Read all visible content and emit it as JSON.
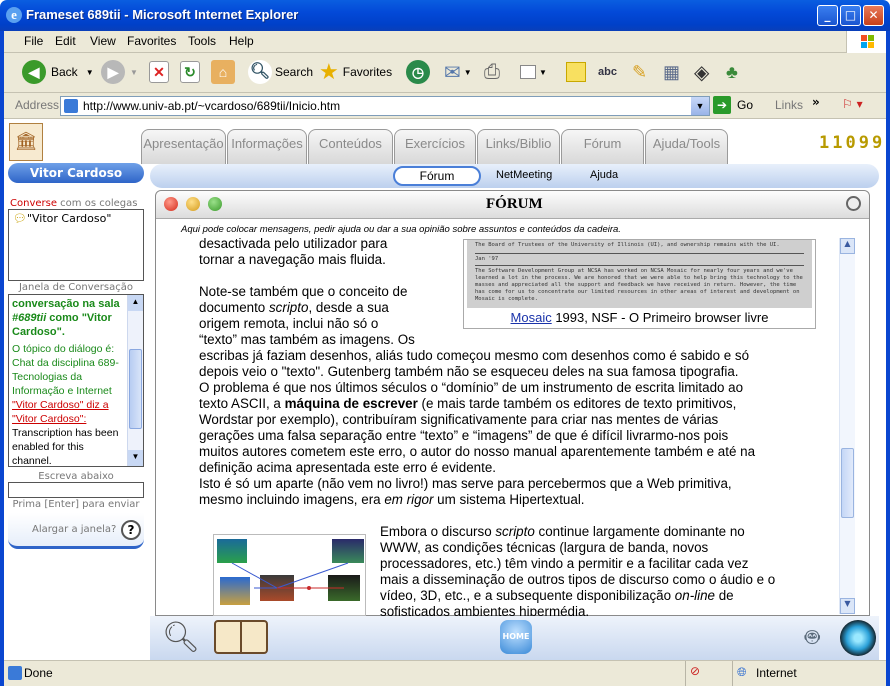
{
  "window": {
    "title": "Frameset 689tii - Microsoft Internet Explorer"
  },
  "menu": [
    "File",
    "Edit",
    "View",
    "Favorites",
    "Tools",
    "Help"
  ],
  "toolbar": {
    "back": "Back",
    "search": "Search",
    "favorites": "Favorites"
  },
  "address": {
    "label": "Address",
    "url": "http://www.univ-ab.pt/~vcardoso/689tii/Inicio.htm",
    "go": "Go",
    "links": "Links"
  },
  "status": {
    "text": "Done",
    "zone": "Internet"
  },
  "site": {
    "counter": "11099",
    "user_name": "Vitor Cardoso",
    "tabs": [
      "Apresentação",
      "Informações",
      "Conteúdos",
      "Exercícios",
      "Links/Biblio",
      "Fórum",
      "Ajuda/Tools"
    ],
    "subnav": [
      "Fórum",
      "NetMeeting",
      "Ajuda"
    ]
  },
  "chat": {
    "converse_hl": "Converse",
    "converse_rest": " com os colegas",
    "participant": "\"Vitor Cardoso\"",
    "janela_label": "Janela de Conversação",
    "log_line1": "conversação na sala ",
    "log_room": "#689tii",
    "log_line1b": " como \"Vitor Cardoso\".",
    "log_topic": "O tópico do diálogo é: Chat da disciplina 689-Tecnologias da Informação e Internet",
    "log_user1": "\"Vitor Cardoso\" diz a",
    "log_user2": "\"Vitor Cardoso\":",
    "log_msg": "Transcription has been enabled for this channel.",
    "write_label": "Escreva abaixo",
    "hint": "Prima [Enter] para enviar",
    "enlarge": "Alargar a janela?",
    "help_glyph": "?"
  },
  "forum": {
    "title": "FÓRUM",
    "subtitle": "Aqui pode colocar mensagens, pedir ajuda ou dar a sua opinião sobre assuntos e conteúdos da cadeira.",
    "p0a": "desactivada pelo utilizador para",
    "p0b": "tornar a navegação mais fluida.",
    "p1a": "Note-se também que o conceito de",
    "p1b_pre": "documento ",
    "p1b_em": "scripto",
    "p1b_post": ", desde a sua",
    "p1c": "origem remota, inclui não só o",
    "p1d": "“texto” mas também as imagens. Os",
    "p1e": "escribas já faziam desenhos, aliás tudo começou mesmo com desenhos como é sabido e só",
    "p1f": "depois veio o \"texto\". Gutenberg também não se esqueceu deles na sua famosa tipografia.",
    "p1g": "O problema é que nos últimos séculos o “domínio” de um instrumento de escrita limitado ao",
    "p1h_pre": "texto ASCII, a ",
    "p1h_b": "máquina de escrever",
    "p1h_post": " (e mais tarde também os editores de texto primitivos,",
    "p1i": "Wordstar por exemplo), contribuíram significativamente para criar nas mentes de várias",
    "p1j": "gerações uma falsa separação entre “texto” e “imagens” de que é difícil livrarmo-nos pois",
    "p1k": "muitos autores cometem este erro, o autor do nosso manual aparentemente também e até na",
    "p1l": "definição acima apresentada este erro é evidente.",
    "p2a": "Isto é só um aparte (não vem no livro!) mas serve para percebermos que a Web primitiva,",
    "p2b_pre": "mesmo incluindo imagens, era ",
    "p2b_em": "em rigor",
    "p2b_post": " um sistema Hipertextual.",
    "p3a_pre": "Embora o discurso ",
    "p3a_em": "scripto",
    "p3a_post": " continue largamente dominante no",
    "p3b": "WWW, as condições técnicas (largura de banda, novos",
    "p3c": "processadores, etc.) têm vindo a permitir e a facilitar cada vez",
    "p3d": "mais a disseminação de outros tipos de discurso como o áudio e o",
    "p3e_pre": "vídeo, 3D, etc., e a subsequente disponibilização ",
    "p3e_em": "on-line",
    "p3e_post": " de",
    "p3f": "sofisticados ambientes hipermédia.",
    "caption_link": "Mosaic",
    "caption_rest": " 1993, NSF - O Primeiro browser livre",
    "scan1": "The Board of Trustees of the University of Illinois (UI), and ownership remains with the UI.",
    "scan2": "Jan '97",
    "scan3": "The Software Development Group at NCSA has worked on NCSA Mosaic for nearly four years and we've learned a lot in the process. We are honored that we were able to help bring this technology to the masses and appreciated all the support and feedback we have received in return. However, the time has come for us to concentrate our limited resources in other areas of interest and development on Mosaic is complete."
  },
  "home_label": "HOME",
  "colors": {
    "accent": "#2e64c8",
    "chat_green": "#1a8a1a",
    "chat_red": "#cc0000"
  }
}
